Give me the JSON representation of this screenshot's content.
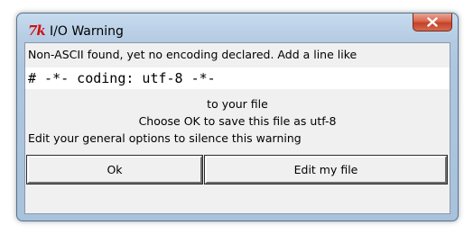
{
  "window": {
    "title": "I/O Warning",
    "logo_text": "7k",
    "close_icon": "close-icon"
  },
  "message": {
    "line1": "Non-ASCII found, yet no encoding declared. Add a line like",
    "code": "# -*- coding: utf-8 -*-",
    "line2": "to your file",
    "line3": "Choose OK to save this file as utf-8",
    "line4": "Edit your general options to silence this warning"
  },
  "buttons": {
    "ok_label": "Ok",
    "edit_label": "Edit my file"
  },
  "colors": {
    "tk_logo": "#d01010",
    "close_button": "#c9462e",
    "frame": "#aec6df"
  }
}
